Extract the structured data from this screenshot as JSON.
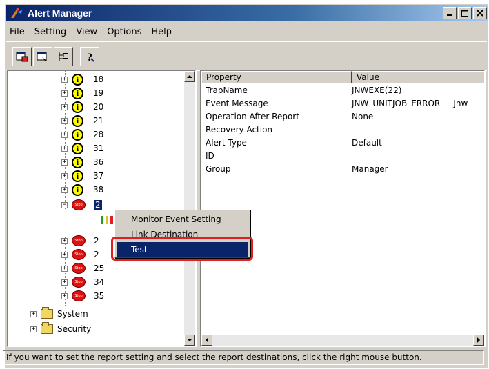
{
  "window": {
    "title": "Alert Manager"
  },
  "menu": [
    "File",
    "Setting",
    "View",
    "Options",
    "Help"
  ],
  "toolbar": {
    "icons": [
      "property-sheet-icon",
      "window-icon",
      "tree-icon",
      "help-icon"
    ]
  },
  "tree": {
    "items": [
      {
        "label": "18",
        "icon": "info-icon"
      },
      {
        "label": "19",
        "icon": "info-icon"
      },
      {
        "label": "20",
        "icon": "info-icon"
      },
      {
        "label": "21",
        "icon": "info-icon"
      },
      {
        "label": "28",
        "icon": "info-icon"
      },
      {
        "label": "31",
        "icon": "info-icon"
      },
      {
        "label": "36",
        "icon": "info-icon"
      },
      {
        "label": "37",
        "icon": "info-icon"
      },
      {
        "label": "38",
        "icon": "info-icon"
      },
      {
        "label": "2",
        "icon": "stop-icon",
        "selected": true
      },
      {
        "label": "2",
        "icon": "stop-icon"
      },
      {
        "label": "2",
        "icon": "stop-icon"
      },
      {
        "label": "25",
        "icon": "stop-icon"
      },
      {
        "label": "34",
        "icon": "stop-icon"
      },
      {
        "label": "35",
        "icon": "stop-icon"
      }
    ],
    "folders": [
      {
        "label": "System"
      },
      {
        "label": "Security"
      }
    ]
  },
  "list": {
    "columns": [
      "Property",
      "Value"
    ],
    "rows": [
      {
        "property": "TrapName",
        "value": "JNWEXE(22)"
      },
      {
        "property": "Event Message",
        "value": "JNW_UNITJOB_ERROR     Jnw"
      },
      {
        "property": "Operation After Report",
        "value": "None"
      },
      {
        "property": "Recovery Action",
        "value": ""
      },
      {
        "property": "Alert Type",
        "value": "Default"
      },
      {
        "property": "ID",
        "value": ""
      },
      {
        "property": "Group",
        "value": "Manager"
      }
    ]
  },
  "context_menu": {
    "items": [
      {
        "label": "Monitor Event Setting"
      },
      {
        "label": "Link Destination"
      },
      {
        "label": "Test",
        "highlighted": true
      }
    ]
  },
  "status": "If you want to set the report setting and select the report destinations, click the right mouse button.",
  "colors": {
    "title_start": "#0a246a",
    "selection": "#0a246a",
    "callout": "#e02020"
  }
}
